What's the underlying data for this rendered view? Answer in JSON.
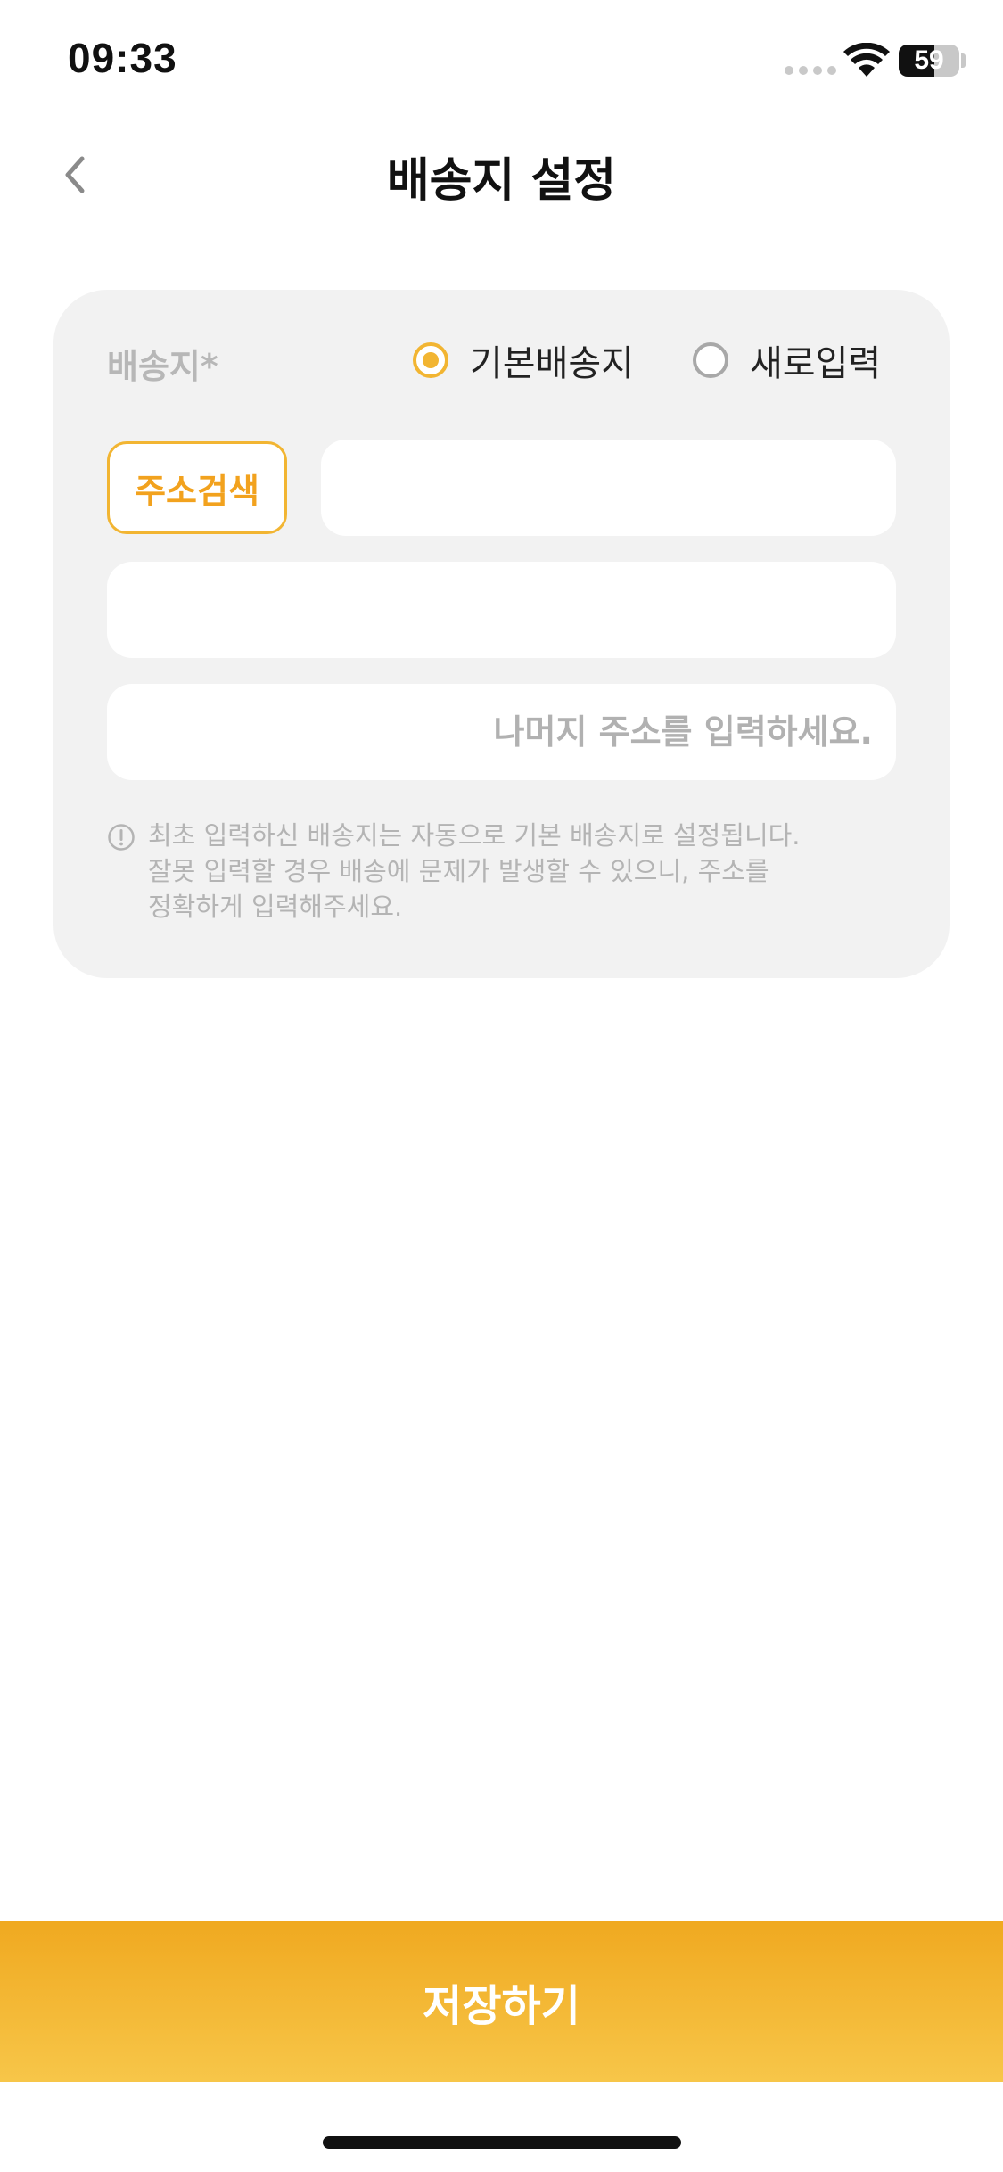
{
  "status": {
    "time": "09:33",
    "battery": "59",
    "battery_level": 0.59
  },
  "header": {
    "title": "배송지 설정"
  },
  "form": {
    "label": "배송지*",
    "radio_options": [
      {
        "label": "기본배송지",
        "selected": true
      },
      {
        "label": "새로입력",
        "selected": false
      }
    ],
    "search_button": "주소검색",
    "zip_value": "",
    "address_value": "",
    "detail_placeholder": "나머지 주소를 입력하세요.",
    "notice_lines": [
      "최초 입력하신 배송지는 자동으로 기본 배송지로 설정됩니다.",
      "잘못 입력할 경우 배송에 문제가 발생할 수 있으니, 주소를",
      "정확하게 입력해주세요."
    ]
  },
  "footer": {
    "save_label": "저장하기"
  },
  "colors": {
    "accent": "#F2B532",
    "accent_dark": "#F0A920",
    "card_bg": "#F2F2F2"
  }
}
